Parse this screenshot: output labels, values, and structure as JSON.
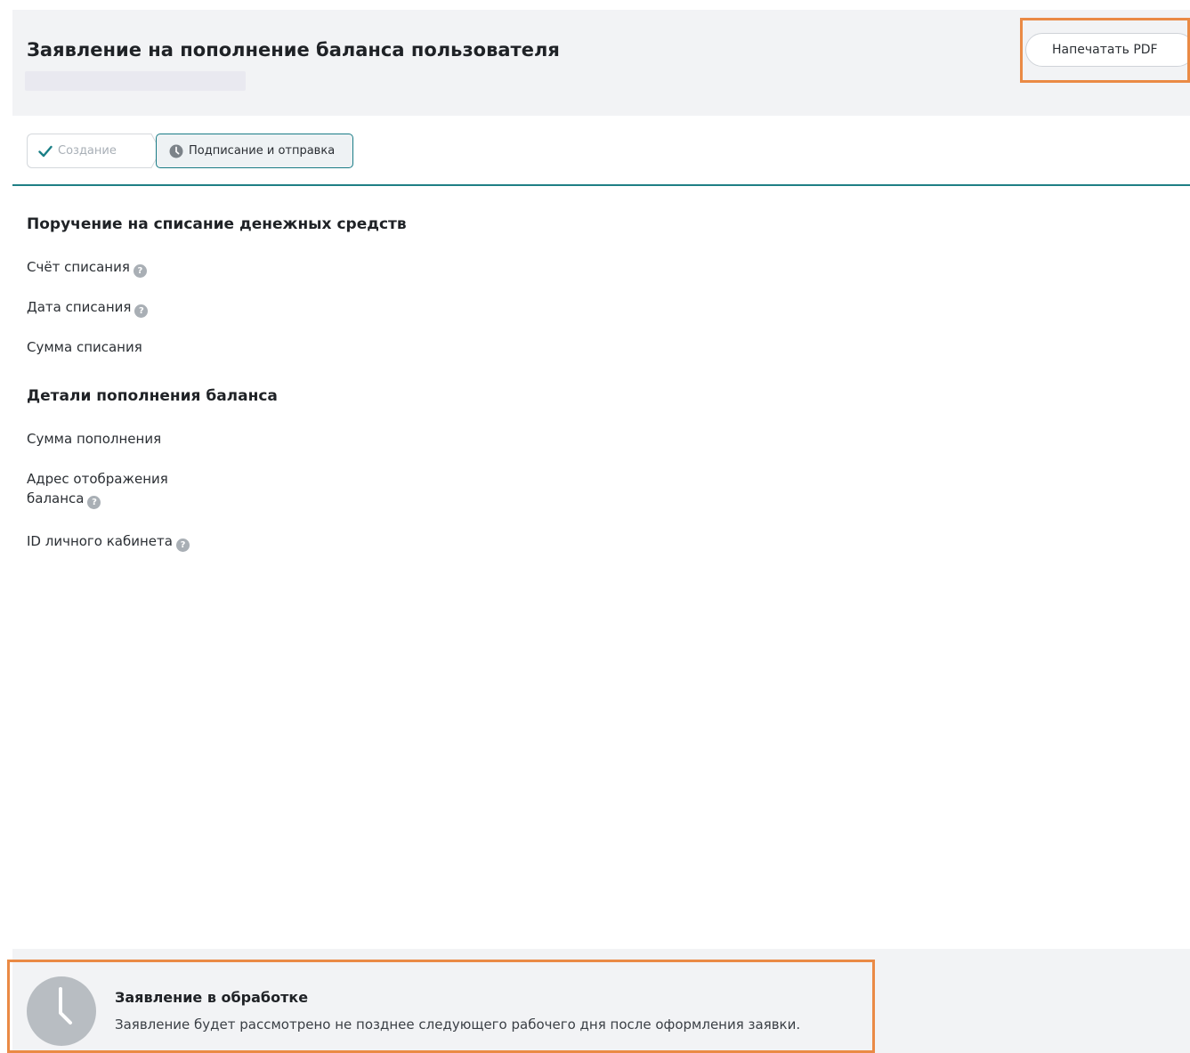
{
  "header": {
    "title": "Заявление на пополнение баланса пользователя",
    "print_button_label": "Напечатать PDF"
  },
  "stepper": {
    "steps": [
      {
        "label": "Создание",
        "state": "done",
        "icon": "check-icon"
      },
      {
        "label": "Подписание и отправка",
        "state": "active",
        "icon": "clock-icon"
      }
    ]
  },
  "sections": [
    {
      "title": "Поручение на списание денежных средств",
      "fields": [
        {
          "label": "Счёт списания",
          "help": true
        },
        {
          "label": "Дата списания",
          "help": true
        },
        {
          "label": "Сумма списания",
          "help": false
        }
      ]
    },
    {
      "title": "Детали пополнения баланса",
      "fields": [
        {
          "label": "Сумма пополнения",
          "help": false
        },
        {
          "label_line1": "Адрес отображения",
          "label_line2": "баланса",
          "help": true
        },
        {
          "label": "ID личного кабинета",
          "help": true
        }
      ]
    }
  ],
  "status": {
    "title": "Заявление в обработке",
    "text": "Заявление будет рассмотрено не позднее следующего рабочего дня после оформления заявки.",
    "icon": "clock-icon"
  },
  "help_glyph": "?",
  "colors": {
    "accent": "#1f7f85",
    "highlight": "#ea8a45",
    "header_bg": "#f2f3f5",
    "check": "#1a7f86",
    "help_icon": "#a9afb5"
  }
}
